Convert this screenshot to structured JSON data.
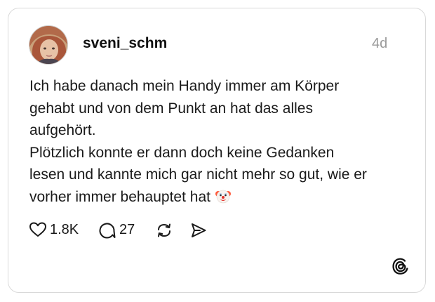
{
  "post": {
    "username": "sveni_schm",
    "time": "4d",
    "lines": [
      "Ich habe danach mein Handy immer am Körper",
      "gehabt und von dem Punkt an hat das alles",
      "aufgehört.",
      "Plötzlich konnte er dann doch keine Gedanken",
      "lesen und kannte mich gar nicht mehr so gut, wie er",
      "vorher immer behauptet hat"
    ],
    "emoji": "clown-face-emoji"
  },
  "actions": {
    "likes": "1.8K",
    "replies": "27"
  },
  "icons": {
    "like": "heart-icon",
    "reply": "comment-icon",
    "repost": "repost-icon",
    "share": "send-icon",
    "brand": "threads-logo-icon"
  }
}
